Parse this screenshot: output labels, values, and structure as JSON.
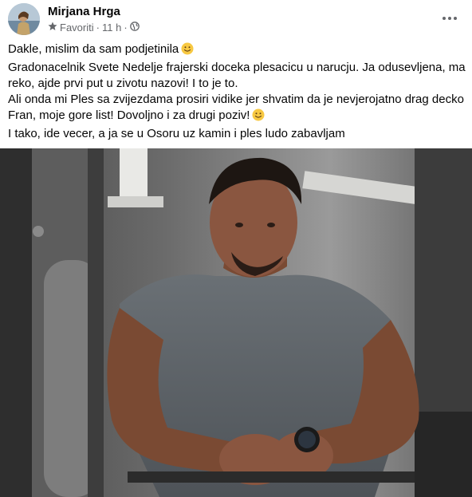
{
  "post": {
    "author": "Mirjana Hrga",
    "audience_label": "Favoriti",
    "separator": "·",
    "timestamp": "11 h",
    "text_lines": [
      "Dakle, mislim da sam podjetinila",
      "Gradonacelnik Svete Nedelje frajerski doceka plesacicu u narucju. Ja odusevljena, ma reko, ajde prvi put u zivotu nazovi! I to je to.",
      "Ali onda mi Ples sa zvijezdama prosiri vidike jer shvatim da je nevjerojatno drag decko Fran, moje gore list! Dovoljno i za drugi poziv!",
      "I tako, ide vecer, a ja se u Osoru uz kamin i ples ludo zabavljam"
    ],
    "emoji_icons": [
      "slightly-smiling-face",
      "slightly-smiling-face"
    ],
    "photo_description": "man in grey t-shirt leaning on gym equipment"
  },
  "icons": {
    "audience": "star-icon",
    "privacy": "globe-icon",
    "more": "more-options-icon"
  },
  "colors": {
    "text": "#050505",
    "meta": "#65676b",
    "emoji": "#f7c842"
  }
}
